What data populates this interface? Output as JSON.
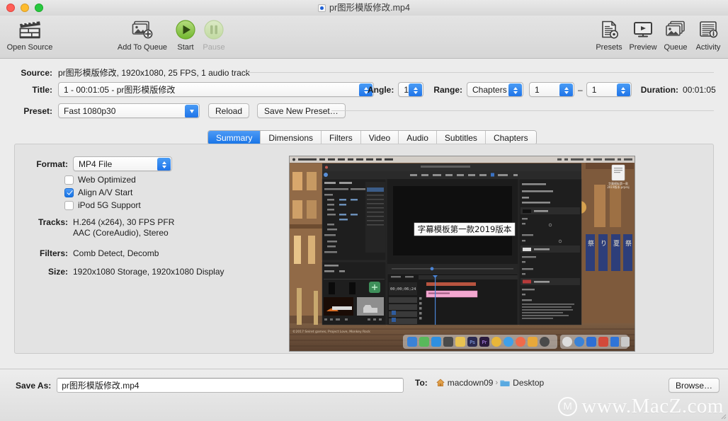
{
  "window": {
    "title": "pr图形模版修改.mp4",
    "doc_icon": "document-dot-icon",
    "traffic": {
      "close": "close-button",
      "minimize": "minimize-button",
      "zoom": "zoom-button"
    }
  },
  "toolbar": {
    "items": [
      {
        "label": "Open Source",
        "icon": "clapperboard-icon",
        "enabled": true
      },
      {
        "label": "Add To Queue",
        "icon": "add-to-queue-icon",
        "enabled": true
      },
      {
        "label": "Start",
        "icon": "play-circle-icon",
        "enabled": true
      },
      {
        "label": "Pause",
        "icon": "pause-circle-icon",
        "enabled": false
      },
      {
        "label": "Presets",
        "icon": "presets-icon",
        "enabled": true
      },
      {
        "label": "Preview",
        "icon": "preview-monitor-icon",
        "enabled": true
      },
      {
        "label": "Queue",
        "icon": "queue-stack-icon",
        "enabled": true
      },
      {
        "label": "Activity",
        "icon": "activity-log-icon",
        "enabled": true
      }
    ],
    "colors": {
      "start_green": "#8cc63f",
      "pause_green_disabled": "#cde0ad"
    }
  },
  "source": {
    "label": "Source:",
    "value": "pr图形模版修改, 1920x1080, 25 FPS, 1 audio track"
  },
  "title_row": {
    "label": "Title:",
    "value": "1 - 00:01:05 - pr图形模版修改",
    "angle_label": "Angle:",
    "angle_value": "1",
    "range_label": "Range:",
    "range_value": "Chapters",
    "range_start": "1",
    "range_dash": "–",
    "range_end": "1",
    "duration_label": "Duration:",
    "duration_value": "00:01:05"
  },
  "preset_row": {
    "label": "Preset:",
    "value": "Fast 1080p30",
    "reload_label": "Reload",
    "save_preset_label": "Save New Preset…"
  },
  "tabs": [
    {
      "label": "Summary",
      "active": true
    },
    {
      "label": "Dimensions",
      "active": false
    },
    {
      "label": "Filters",
      "active": false
    },
    {
      "label": "Video",
      "active": false
    },
    {
      "label": "Audio",
      "active": false
    },
    {
      "label": "Subtitles",
      "active": false
    },
    {
      "label": "Chapters",
      "active": false
    }
  ],
  "summary": {
    "format_label": "Format:",
    "format_value": "MP4 File",
    "checkboxes": [
      {
        "label": "Web Optimized",
        "checked": false
      },
      {
        "label": "Align A/V Start",
        "checked": true
      },
      {
        "label": "iPod 5G Support",
        "checked": false
      }
    ],
    "tracks_label": "Tracks:",
    "tracks_line1": "H.264 (x264), 30 FPS PFR",
    "tracks_line2": "AAC (CoreAudio), Stereo",
    "filters_label": "Filters:",
    "filters_value": "Comb Detect, Decomb",
    "size_label": "Size:",
    "size_value": "1920x1080 Storage, 1920x1080 Display",
    "preview_caption": "字幕模板第一款2019版本"
  },
  "bottom": {
    "save_as_label": "Save As:",
    "save_as_value": "pr图形模版修改.mp4",
    "to_label": "To:",
    "path_home": "macdown09",
    "path_sep": "›",
    "path_folder": "Desktop",
    "browse_label": "Browse…"
  },
  "watermark": {
    "logo": "M",
    "text": "www.MacZ.com"
  }
}
